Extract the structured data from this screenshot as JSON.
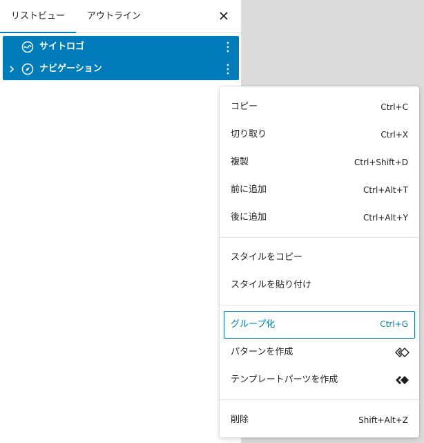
{
  "panel": {
    "tabs": [
      {
        "label": "リストビュー",
        "active": true
      },
      {
        "label": "アウトライン",
        "active": false
      }
    ],
    "close_icon": "close-icon"
  },
  "tree": {
    "items": [
      {
        "label": "サイトロゴ",
        "icon": "site-logo-icon",
        "expandable": false
      },
      {
        "label": "ナビゲーション",
        "icon": "navigation-icon",
        "expandable": true
      }
    ],
    "highlight_color": "#007cba"
  },
  "menu": {
    "groups": [
      {
        "items": [
          {
            "label": "コピー",
            "shortcut": "Ctrl+C"
          },
          {
            "label": "切り取り",
            "shortcut": "Ctrl+X"
          },
          {
            "label": "複製",
            "shortcut": "Ctrl+Shift+D"
          },
          {
            "label": "前に追加",
            "shortcut": "Ctrl+Alt+T"
          },
          {
            "label": "後に追加",
            "shortcut": "Ctrl+Alt+Y"
          }
        ]
      },
      {
        "items": [
          {
            "label": "スタイルをコピー"
          },
          {
            "label": "スタイルを貼り付け"
          }
        ]
      },
      {
        "items": [
          {
            "label": "グループ化",
            "shortcut": "Ctrl+G",
            "focused": true
          },
          {
            "label": "パターンを作成",
            "icon": "pattern-outline-icon"
          },
          {
            "label": "テンプレートパーツを作成",
            "icon": "template-part-filled-icon"
          }
        ]
      },
      {
        "items": [
          {
            "label": "削除",
            "shortcut": "Shift+Alt+Z"
          }
        ]
      }
    ],
    "accent_color": "#007cba"
  }
}
